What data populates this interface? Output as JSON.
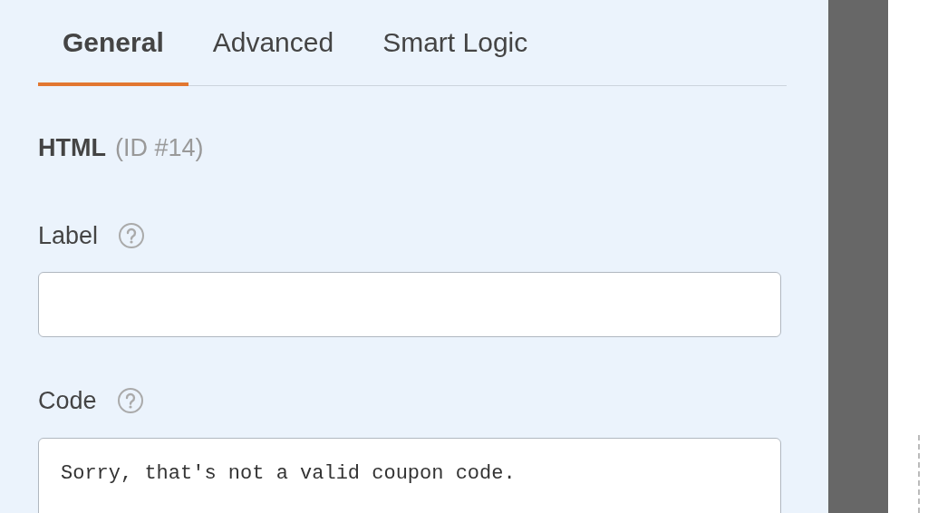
{
  "tabs": [
    {
      "label": "General",
      "selected": true
    },
    {
      "label": "Advanced",
      "selected": false
    },
    {
      "label": "Smart Logic",
      "selected": false
    }
  ],
  "field_heading": {
    "title": "HTML",
    "id": "(ID #14)"
  },
  "fields": [
    {
      "kind": "input",
      "label": "Label"
    },
    {
      "kind": "textarea",
      "label": "Code",
      "value": "Sorry, that's not a valid coupon code."
    }
  ]
}
